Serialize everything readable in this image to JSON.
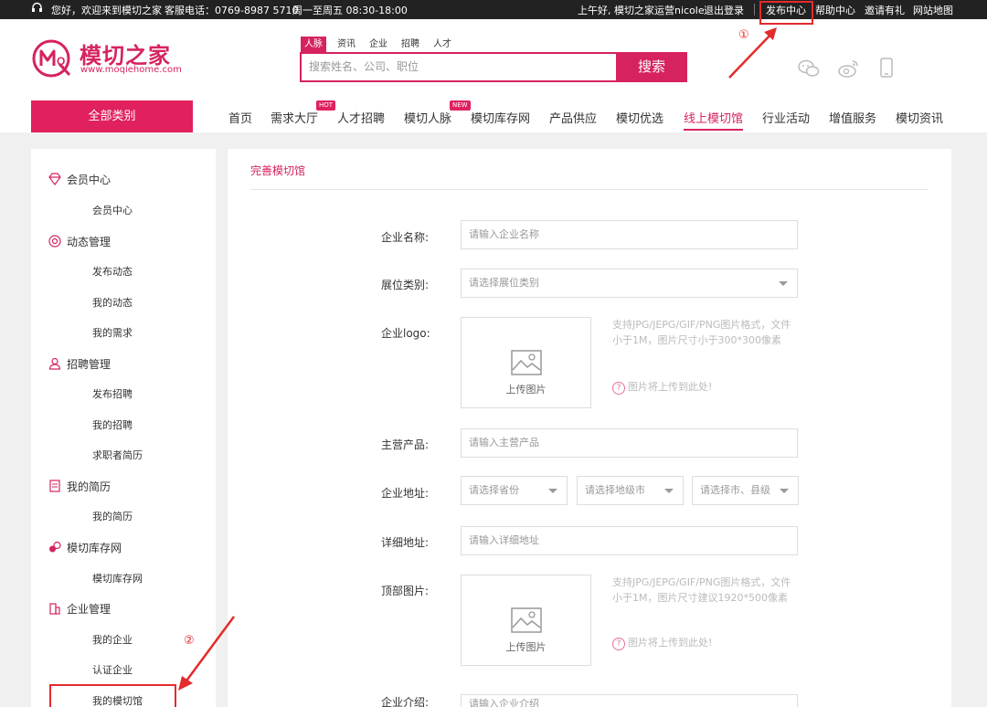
{
  "topbar": {
    "greeting": "您好，欢迎来到模切之家",
    "phone": "客服电话：0769-8987 5710",
    "hours": "周一至周五 08:30-18:00",
    "user": "上午好, 模切之家运营nicole",
    "logout": "退出登录",
    "publish": "发布中心",
    "help": "帮助中心",
    "invite": "邀请有礼",
    "sitemap": "网站地图"
  },
  "logo": {
    "cn": "模切之家",
    "en": "www.moqiehome.com"
  },
  "search": {
    "tabs": [
      "人脉",
      "资讯",
      "企业",
      "招聘",
      "人才"
    ],
    "placeholder": "搜索姓名、公司、职位",
    "button": "搜索"
  },
  "header_icons": [
    "wechat-icon",
    "weibo-icon",
    "mobile-icon"
  ],
  "nav": {
    "all_categories": "全部类别",
    "items": [
      "首页",
      "需求大厅",
      "人才招聘",
      "模切人脉",
      "模切库存网",
      "产品供应",
      "模切优选",
      "线上模切馆",
      "行业活动",
      "增值服务",
      "模切资讯"
    ],
    "active": "线上模切馆",
    "badge_hot": "HOT",
    "badge_new": "NEW"
  },
  "sidebar": {
    "groups": [
      {
        "label": "会员中心",
        "items": [
          "会员中心"
        ]
      },
      {
        "label": "动态管理",
        "items": [
          "发布动态",
          "我的动态",
          "我的需求"
        ]
      },
      {
        "label": "招聘管理",
        "items": [
          "发布招聘",
          "我的招聘",
          "求职者简历"
        ]
      },
      {
        "label": "我的简历",
        "items": [
          "我的简历"
        ]
      },
      {
        "label": "模切库存网",
        "items": [
          "模切库存网"
        ]
      },
      {
        "label": "企业管理",
        "items": [
          "我的企业",
          "认证企业",
          "我的模切馆"
        ]
      }
    ]
  },
  "form": {
    "title": "完善模切馆",
    "company_name_label": "企业名称:",
    "company_name_placeholder": "请输入企业名称",
    "booth_label": "展位类别:",
    "booth_placeholder": "请选择展位类别",
    "logo_label": "企业logo:",
    "upload_label": "上传图片",
    "logo_hint": "支持JPG/JEPG/GIF/PNG图片格式，文件小于1M，图片尺寸小于300*300像素",
    "upload_note": "图片将上传到此处!",
    "product_label": "主营产品:",
    "product_placeholder": "请输入主营产品",
    "address_label": "企业地址:",
    "province_placeholder": "请选择省份",
    "city_placeholder": "请选择地级市",
    "county_placeholder": "请选择市、县级",
    "detail_label": "详细地址:",
    "detail_placeholder": "请输入详细地址",
    "banner_label": "顶部图片:",
    "banner_hint": "支持JPG/JEPG/GIF/PNG图片格式，文件 小于1M，图片尺寸建议1920*500像素",
    "intro_label": "企业介绍:",
    "intro_placeholder": "请输入企业介绍"
  },
  "annotations": {
    "step1": "①",
    "step2": "②"
  },
  "colors": {
    "brand": "#d6235f",
    "topbar": "#222222",
    "annotation": "#e32b2b"
  }
}
